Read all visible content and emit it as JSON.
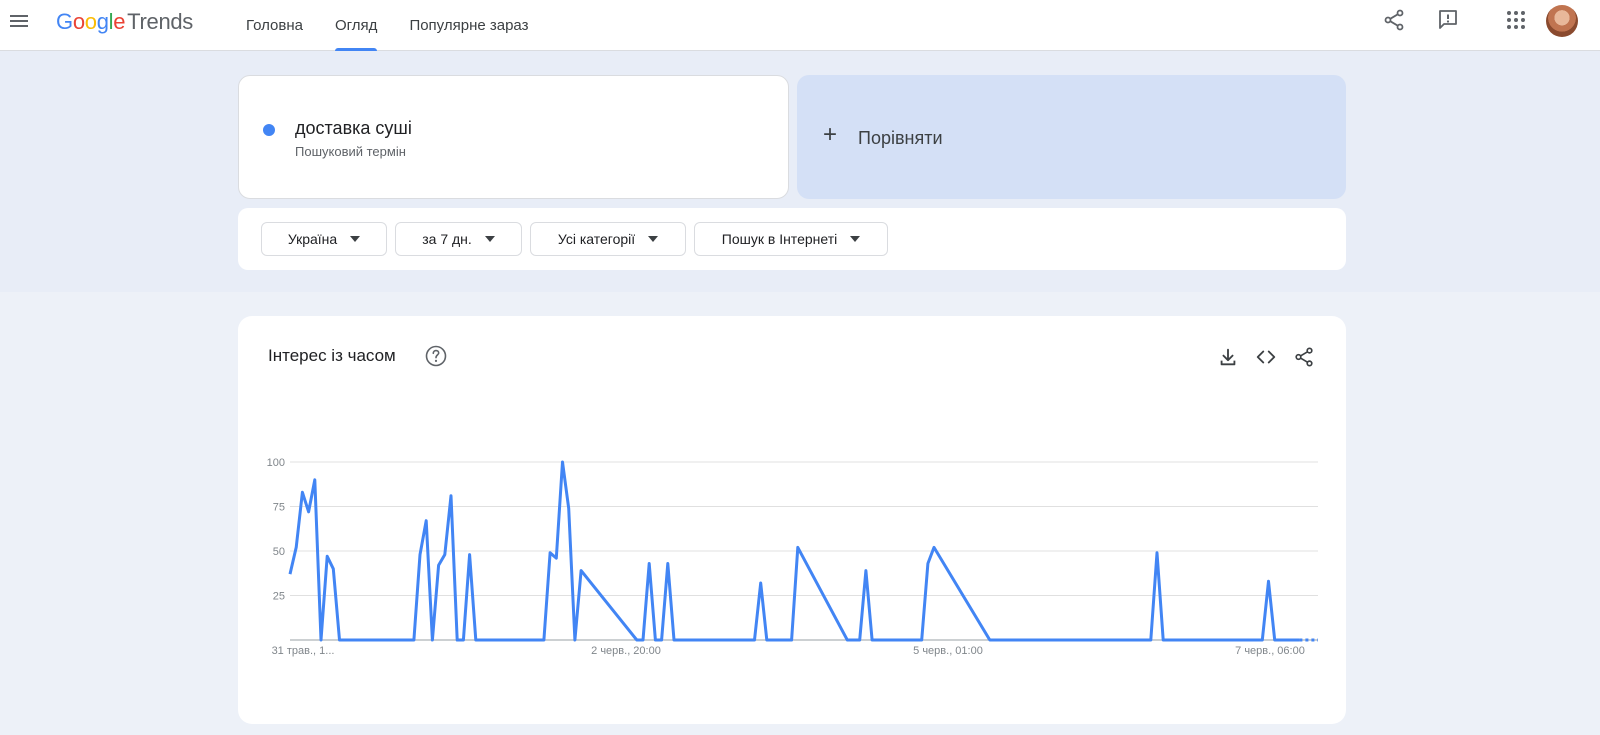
{
  "header": {
    "logo": {
      "g1": "G",
      "g2": "o",
      "g3": "o",
      "g4": "g",
      "g5": "l",
      "g6": "e",
      "trends": "Trends"
    },
    "tabs": [
      {
        "label": "Головна"
      },
      {
        "label": "Огляд",
        "active": true
      },
      {
        "label": "Популярне зараз"
      }
    ],
    "icons": [
      "menu-icon",
      "share-icon",
      "feedback-icon",
      "apps-icon",
      "avatar"
    ]
  },
  "search": {
    "term": "доставка суші",
    "term_type": "Пошуковий термін",
    "term_color": "#4285f4",
    "compare_label": "Порівняти"
  },
  "filters": {
    "region": "Україна",
    "period": "за 7 дн.",
    "category": "Усі категорії",
    "search_type": "Пошук в Інтернеті"
  },
  "chart_card": {
    "title": "Інтерес із часом",
    "icons": [
      "help-icon",
      "download-icon",
      "embed-icon",
      "share-icon"
    ]
  },
  "chart_data": {
    "type": "line",
    "title": "Інтерес із часом",
    "xlabel": "",
    "ylabel": "",
    "ylim": [
      0,
      100
    ],
    "y_ticks": [
      "100",
      "75",
      "50",
      "25"
    ],
    "x_tick_labels": [
      "31 трав., 1...",
      "2 черв., 20:00",
      "5 черв., 01:00",
      "7 черв., 06:00"
    ],
    "grid": true,
    "series": [
      {
        "color": "#4285f4",
        "x": [
          0,
          1,
          2,
          3,
          4,
          5,
          6,
          7,
          8,
          9,
          10,
          20,
          21,
          22,
          23,
          24,
          25,
          26,
          27,
          28,
          29,
          30,
          40,
          41,
          42,
          43,
          44,
          45,
          46,
          47,
          56,
          57,
          58,
          59,
          60,
          61,
          62,
          63,
          64,
          75,
          76,
          77,
          78,
          79,
          80,
          81,
          82,
          90,
          91,
          92,
          93,
          94,
          102,
          103,
          104,
          113,
          114,
          115,
          116,
          117,
          118,
          119,
          139,
          140,
          141,
          142,
          143,
          152,
          153,
          154,
          155,
          156,
          157,
          158,
          159,
          163,
          164,
          165,
          166
        ],
        "y": [
          37,
          52,
          83,
          72,
          90,
          0,
          47,
          40,
          0,
          0,
          0,
          0,
          48,
          67,
          0,
          42,
          48,
          81,
          0,
          0,
          48,
          0,
          0,
          0,
          49,
          46,
          100,
          74,
          0,
          39,
          0,
          0,
          43,
          0,
          0,
          43,
          0,
          0,
          0,
          0,
          32,
          0,
          0,
          0,
          0,
          0,
          52,
          0,
          0,
          0,
          39,
          0,
          0,
          43,
          52,
          0,
          0,
          0,
          0,
          0,
          0,
          0,
          0,
          49,
          0,
          0,
          0,
          0,
          0,
          0,
          0,
          0,
          0,
          33,
          0,
          0,
          0,
          0,
          0
        ],
        "x_max": 166,
        "partial_from": 163
      }
    ]
  }
}
